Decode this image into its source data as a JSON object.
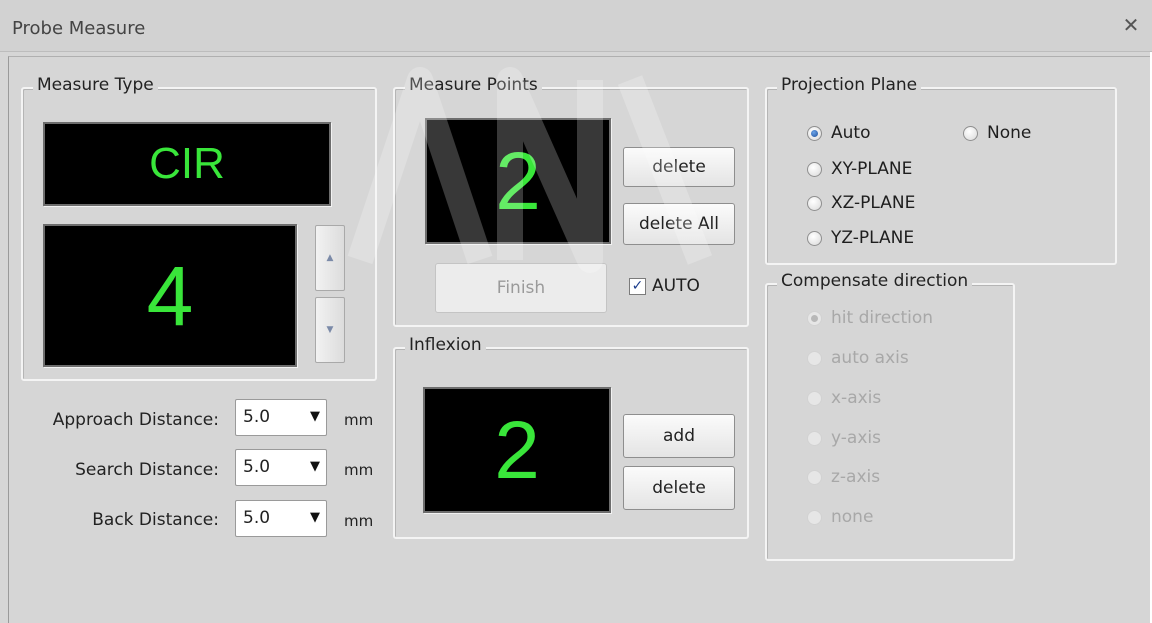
{
  "window": {
    "title": "Probe Measure",
    "close_icon": "close-icon"
  },
  "measure_type": {
    "legend": "Measure Type",
    "type_value": "CIR",
    "count_value": "4"
  },
  "distances": {
    "approach": {
      "label": "Approach Distance:",
      "value": "5.0",
      "unit": "mm"
    },
    "search": {
      "label": "Search Distance:",
      "value": "5.0",
      "unit": "mm"
    },
    "back": {
      "label": "Back Distance:",
      "value": "5.0",
      "unit": "mm"
    }
  },
  "measure_points": {
    "legend": "Measure Points",
    "count": "2",
    "delete_label": "delete",
    "delete_all_label": "delete All",
    "finish_label": "Finish",
    "auto_label": "AUTO",
    "auto_checked": true
  },
  "inflexion": {
    "legend": "Inflexion",
    "count": "2",
    "add_label": "add",
    "delete_label": "delete"
  },
  "projection_plane": {
    "legend": "Projection Plane",
    "options": [
      {
        "label": "Auto",
        "checked": true
      },
      {
        "label": "None",
        "checked": false
      },
      {
        "label": "XY-PLANE",
        "checked": false
      },
      {
        "label": "XZ-PLANE",
        "checked": false
      },
      {
        "label": "YZ-PLANE",
        "checked": false
      }
    ]
  },
  "compensate_direction": {
    "legend": "Compensate direction",
    "disabled": true,
    "options": [
      {
        "label": "hit direction",
        "checked": true
      },
      {
        "label": "auto axis",
        "checked": false
      },
      {
        "label": "x-axis",
        "checked": false
      },
      {
        "label": "y-axis",
        "checked": false
      },
      {
        "label": "z-axis",
        "checked": false
      },
      {
        "label": "none",
        "checked": false
      }
    ]
  },
  "colors": {
    "display_digits": "#39e63a",
    "display_bg": "#000000",
    "dialog_bg": "#d6d6d6"
  }
}
